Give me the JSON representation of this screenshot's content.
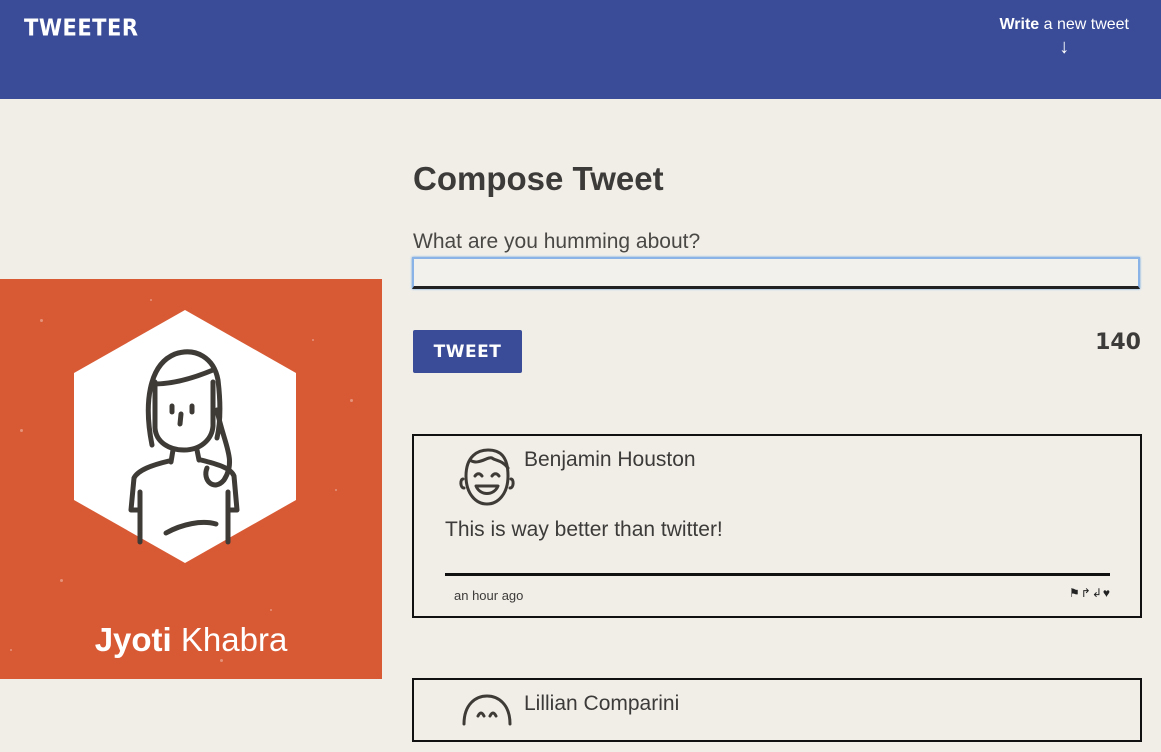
{
  "nav": {
    "logo": "TWEETER",
    "write_bold": "Write",
    "write_rest": " a new tweet",
    "write_arrow": "↓"
  },
  "profile": {
    "first_name": "Jyoti",
    "last_name": "Khabra",
    "bg_color": "#d85a35",
    "avatar_icon": "woman-avatar-icon"
  },
  "compose": {
    "title": "Compose Tweet",
    "label": "What are you humming about?",
    "input_value": "",
    "button_label": "TWEET",
    "counter": "140"
  },
  "tweets": [
    {
      "author": "Benjamin Houston",
      "text": "This is way better than twitter!",
      "time": "an hour ago",
      "actions": [
        "⚑",
        "↱",
        "↲",
        "♥"
      ]
    },
    {
      "author": "Lillian Comparini"
    }
  ],
  "colors": {
    "header": "#3a4c97",
    "background": "#f1eee8",
    "profile": "#d85a35"
  }
}
